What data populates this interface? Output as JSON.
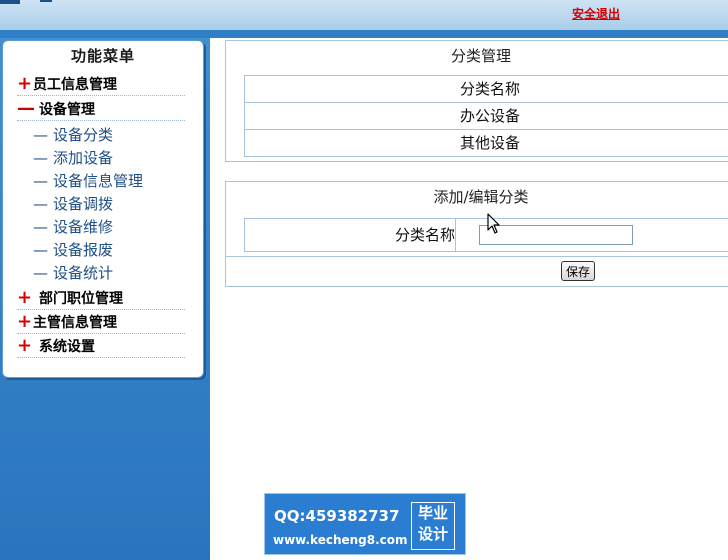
{
  "header": {
    "logout_label": "安全退出"
  },
  "menu": {
    "title": "功能菜单",
    "groups": [
      {
        "label": "员工信息管理",
        "symbol": "+"
      },
      {
        "label": "设备管理",
        "symbol": "—"
      },
      {
        "label": "部门职位管理",
        "symbol": "+"
      },
      {
        "label": "主管信息管理",
        "symbol": "+"
      },
      {
        "label": "系统设置",
        "symbol": "+"
      }
    ],
    "sub_items": [
      {
        "label": "设备分类"
      },
      {
        "label": "添加设备"
      },
      {
        "label": "设备信息管理"
      },
      {
        "label": "设备调拨"
      },
      {
        "label": "设备维修"
      },
      {
        "label": "设备报废"
      },
      {
        "label": "设备统计"
      }
    ],
    "sub_prefix": "—"
  },
  "category_panel": {
    "title": "分类管理",
    "column_header": "分类名称",
    "rows": [
      "办公设备",
      "其他设备"
    ]
  },
  "edit_panel": {
    "title": "添加/编辑分类",
    "field_label": "分类名称",
    "field_value": "",
    "save_label": "保存"
  },
  "watermark": {
    "qq": "QQ:459382737",
    "site": "www.kecheng8.com",
    "badge_line1": "毕业",
    "badge_line2": "设计"
  },
  "colors": {
    "accent_blue": "#2f7fc6",
    "logout_red": "#d40000",
    "plus_red": "#d40000",
    "submenu_text": "#1f4f86"
  },
  "icons": {
    "cursor": "mouse-pointer-icon"
  }
}
